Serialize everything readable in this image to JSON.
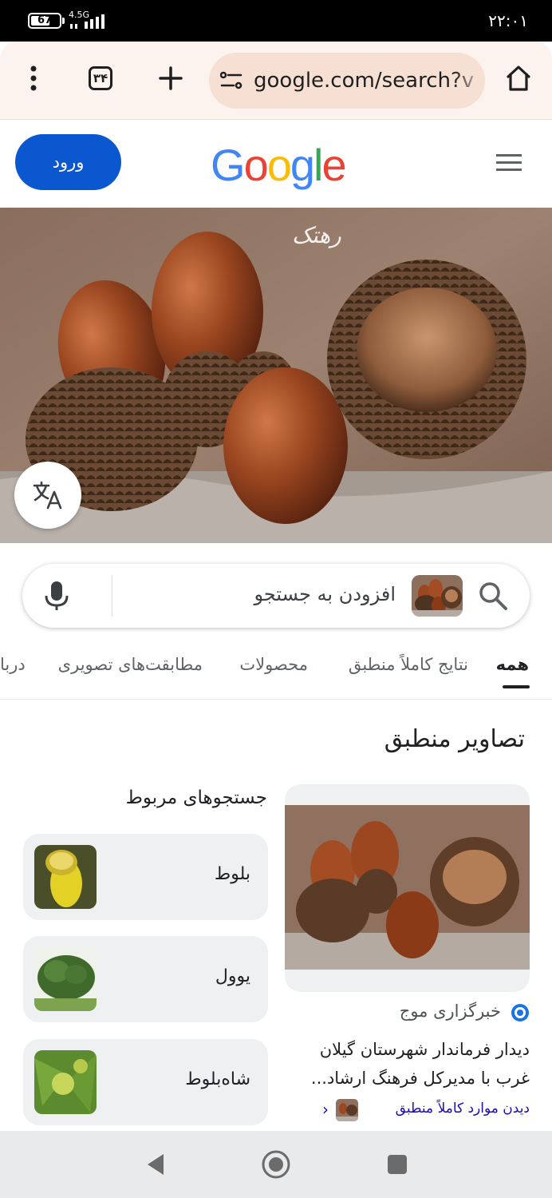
{
  "status_bar": {
    "battery_level": "67",
    "battery_fraction": 0.67,
    "network_type": "4.5G",
    "time": "۲۲:۰۱"
  },
  "browser": {
    "url": "google.com/search?v",
    "tab_count": "۳۴",
    "icons": [
      "more-vert-icon",
      "tabs-icon",
      "new-tab-icon",
      "site-settings-icon",
      "home-icon"
    ]
  },
  "header": {
    "signin_label": "ورود",
    "logo_letters": [
      "G",
      "o",
      "o",
      "g",
      "l",
      "e"
    ],
    "logo_colors": [
      "#4285F4",
      "#EA4335",
      "#FBBC05",
      "#4285F4",
      "#34A853",
      "#EA4335"
    ]
  },
  "hero": {
    "watermark": "رهتک"
  },
  "search": {
    "placeholder": "افزودن به جستجو"
  },
  "tabs": [
    {
      "label": "همه",
      "active": true
    },
    {
      "label": "نتایج کاملاً منطبق",
      "active": false
    },
    {
      "label": "محصولات",
      "active": false
    },
    {
      "label": "مطابقت‌های تصویری",
      "active": false
    },
    {
      "label": "دربا",
      "active": false
    }
  ],
  "results": {
    "section_title": "تصاویر منطبق",
    "related_title": "جستجوهای مربوط",
    "related": [
      {
        "label": "بلوط"
      },
      {
        "label": "یوول"
      },
      {
        "label": "شاه‌بلوط"
      }
    ],
    "match": {
      "source": "خبرگزاری موج",
      "description": "دیدار فرماندار شهرستان گیلان غرب با مدیرکل فرهنگ ارشاد...",
      "exact_link": "دیدن موارد کاملاً منطبق"
    }
  },
  "colors": {
    "accent": "#0b57d0",
    "toolbar_bg": "#fdf3ee",
    "url_bg": "#f6dfd3",
    "link": "#1a0dab"
  }
}
